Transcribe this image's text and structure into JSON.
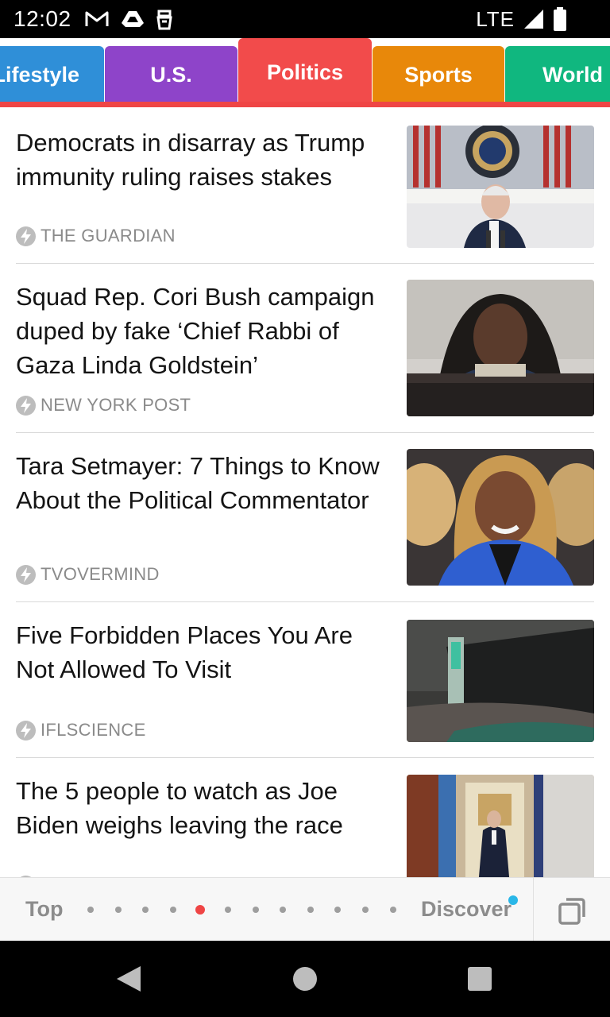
{
  "status_bar": {
    "time": "12:02",
    "network": "LTE",
    "left_icons": [
      "gmail-icon",
      "drive-icon",
      "cleaning-icon"
    ],
    "right_icons": [
      "signal-icon",
      "battery-icon"
    ]
  },
  "tabs": [
    {
      "label": "Lifestyle",
      "color": "#2f8fd8",
      "active": false
    },
    {
      "label": "U.S.",
      "color": "#8e44c9",
      "active": false
    },
    {
      "label": "Politics",
      "color": "#f24b4b",
      "active": true
    },
    {
      "label": "Sports",
      "color": "#e8880a",
      "active": false
    },
    {
      "label": "World",
      "color": "#10b77f",
      "active": false
    }
  ],
  "articles": [
    {
      "headline": "Democrats in disarray as Trump immunity ruling raises stakes",
      "source": "THE GUARDIAN",
      "image": "biden-at-podium"
    },
    {
      "headline": "Squad  Rep. Cori Bush campaign duped by fake ‘Chief Rabbi of Gaza Linda Goldstein’",
      "source": "NEW YORK POST",
      "image": "cori-bush-hearing"
    },
    {
      "headline": "Tara Setmayer: 7 Things to Know About the Political Commentator",
      "source": "TVOVERMIND",
      "image": "tara-setmayer-portrait"
    },
    {
      "headline": "Five Forbidden Places You Are Not Allowed To Visit",
      "source": "IFLSCIENCE",
      "image": "seed-vault-building"
    },
    {
      "headline": "The 5 people to watch as Joe Biden weighs leaving the race",
      "source": "",
      "image": "biden-white-house-doorway"
    }
  ],
  "page_nav": {
    "top_label": "Top",
    "discover_label": "Discover",
    "page_count": 12,
    "active_page": 5
  },
  "colors": {
    "accent": "#ef4545",
    "discover_badge": "#2ab7e8"
  }
}
